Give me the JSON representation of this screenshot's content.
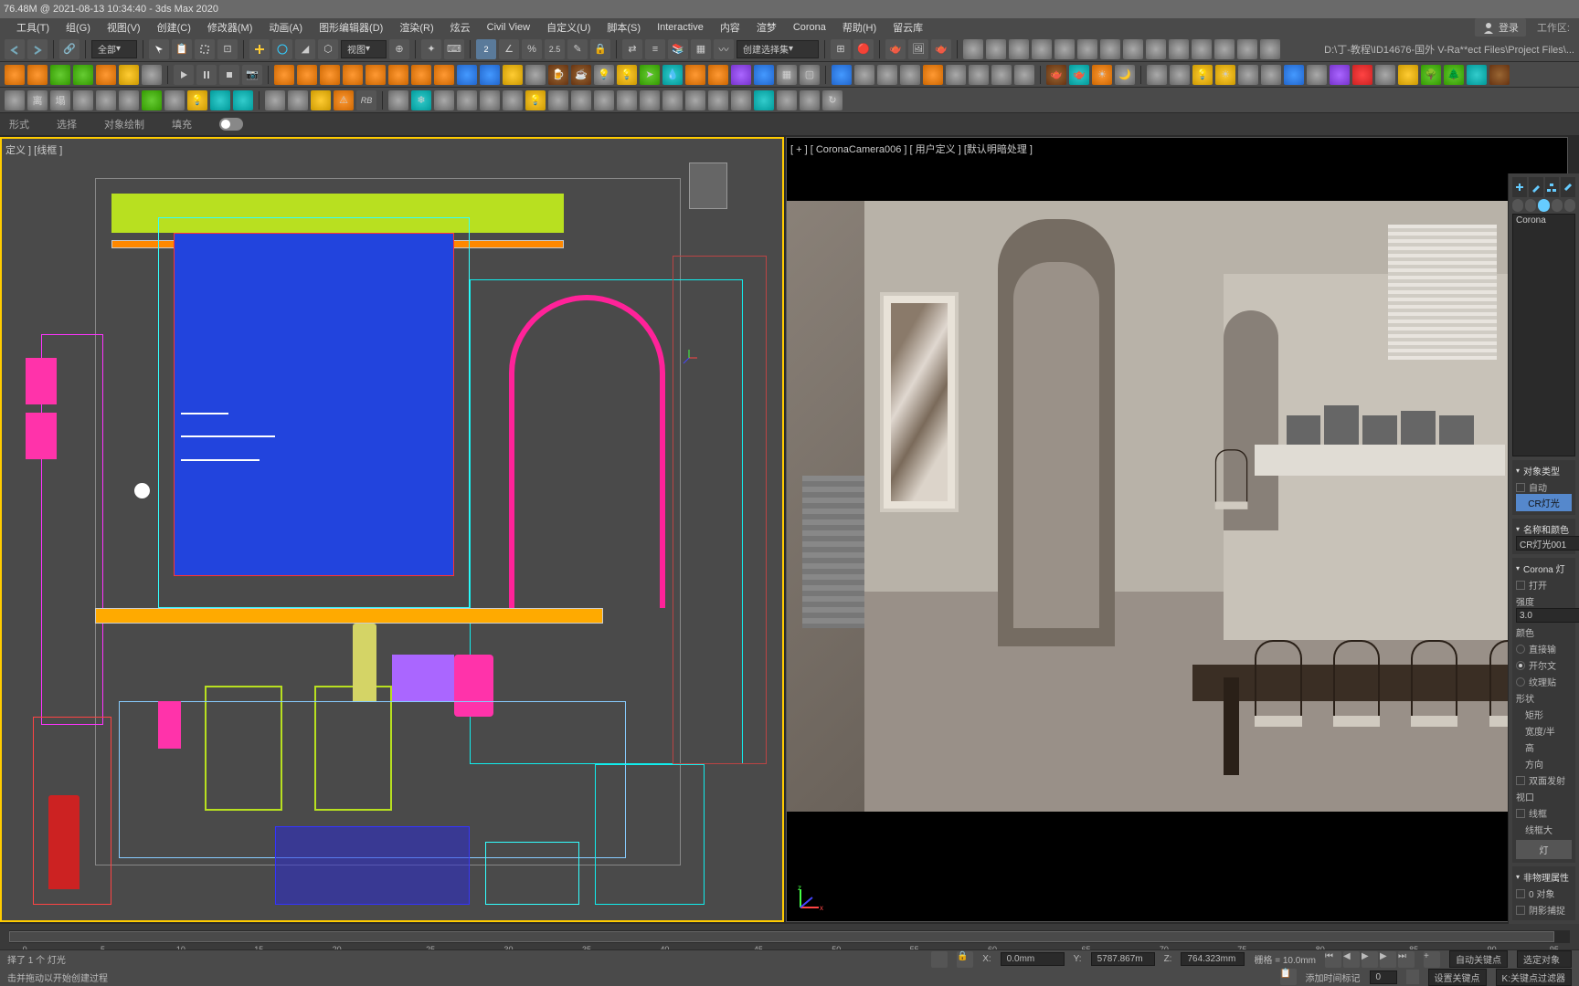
{
  "titlebar": "76.48M @ 2021-08-13 10:34:40 - 3ds Max 2020",
  "menu": {
    "tools": "工具(T)",
    "group": "组(G)",
    "views": "视图(V)",
    "create": "创建(C)",
    "modifiers": "修改器(M)",
    "animation": "动画(A)",
    "graph": "图形编辑器(D)",
    "rendering": "渲染(R)",
    "fx": "炫云",
    "civil": "Civil View",
    "customize": "自定义(U)",
    "scripting": "脚本(S)",
    "interactive": "Interactive",
    "content": "内容",
    "substance": "渲梦",
    "corona": "Corona",
    "help": "帮助(H)",
    "cloud": "留云库",
    "login": "登录",
    "workspace": "工作区:"
  },
  "toolbar1": {
    "all": "全部",
    "view_mode": "视图",
    "create_selset": "创建选择集"
  },
  "toolbar3_label": "RB",
  "path": "D:\\丁-教程\\ID14676-国外 V-Ra**ect Files\\Project Files\\...",
  "submenu": {
    "mode": "形式",
    "select": "选择",
    "object_paint": "对象绘制",
    "fill": "填充"
  },
  "viewport_left": {
    "label": "定义 ] [线框 ]"
  },
  "viewport_right": {
    "label": "[ + ]  [ CoronaCamera006 ]  [ 用户定义 ]  [默认明暗处理 ]"
  },
  "panel": {
    "corona": "Corona",
    "obj_type": "对象类型",
    "auto": "自动",
    "cr_light": "CR灯光",
    "name_color": "名称和颜色",
    "light_name": "CR灯光001",
    "corona_light": "Corona 灯",
    "open": "打开",
    "intensity": "强度",
    "intensity_val": "3.0",
    "color": "颜色",
    "direct": "直接输",
    "kelvin": "开尔文",
    "texmap": "纹理贴",
    "shape": "形状",
    "rect": "矩形",
    "width": "宽度/半",
    "height": "高",
    "direction": "方向",
    "double_sided": "双面发射",
    "viewport": "视口",
    "wireframe": "线框",
    "wireframe_size": "线框大",
    "light_btn": "灯",
    "nonphys": "非物理属性",
    "bounce": "0 对象",
    "shadow_catch": "阴影捕捉"
  },
  "timeline": {
    "ticks": [
      "0",
      "5",
      "10",
      "15",
      "20",
      "25",
      "30",
      "35",
      "40",
      "45",
      "50",
      "55",
      "60",
      "65",
      "70",
      "75",
      "80",
      "85",
      "90",
      "95"
    ]
  },
  "status": {
    "selection": "择了 1 个 灯光",
    "hint": "击并拖动以开始创建过程",
    "x_label": "X:",
    "x": "0.0mm",
    "y_label": "Y:",
    "y": "5787.867m",
    "z_label": "Z:",
    "z": "764.323mm",
    "grid": "栅格 = 10.0mm",
    "autokey": "自动关键点",
    "selected_obj": "选定对象",
    "add_time_tag": "添加时间标记",
    "set_key": "设置关键点",
    "key_filters": "K:关键点过滤器"
  }
}
